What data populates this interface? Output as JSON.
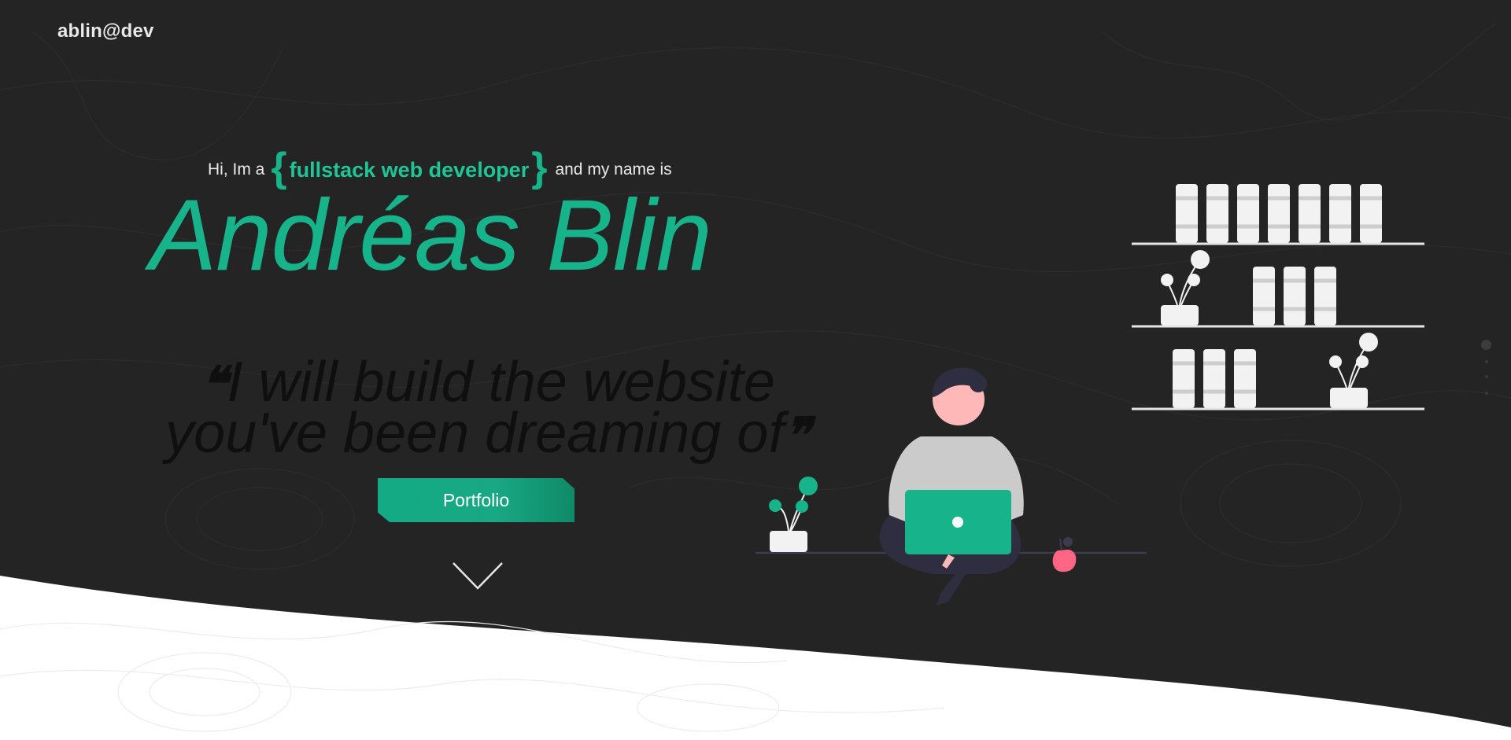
{
  "brand": {
    "name": "ablin@dev"
  },
  "hero": {
    "intro_before": "Hi, Im a",
    "brace_open": "{",
    "role": "fullstack web developer",
    "brace_close": "}",
    "intro_after": "and my name is",
    "name": "Andréas Blin",
    "quote_open": "❝",
    "quote_line1": "I will build the website",
    "quote_line2": "you've been dreaming of",
    "quote_close": "❞",
    "cta_label": "Portfolio"
  },
  "pager": {
    "dot_count": 4,
    "active_index": 0
  },
  "colors": {
    "accent": "#17b48c",
    "background": "#242424",
    "quote_text": "#0f0f0f",
    "footer_wave": "#ffffff"
  },
  "icons": {
    "scroll": "chevron-down-icon",
    "illustration": "developer-with-laptop-illustration",
    "shelves": "bookshelf-illustration"
  }
}
